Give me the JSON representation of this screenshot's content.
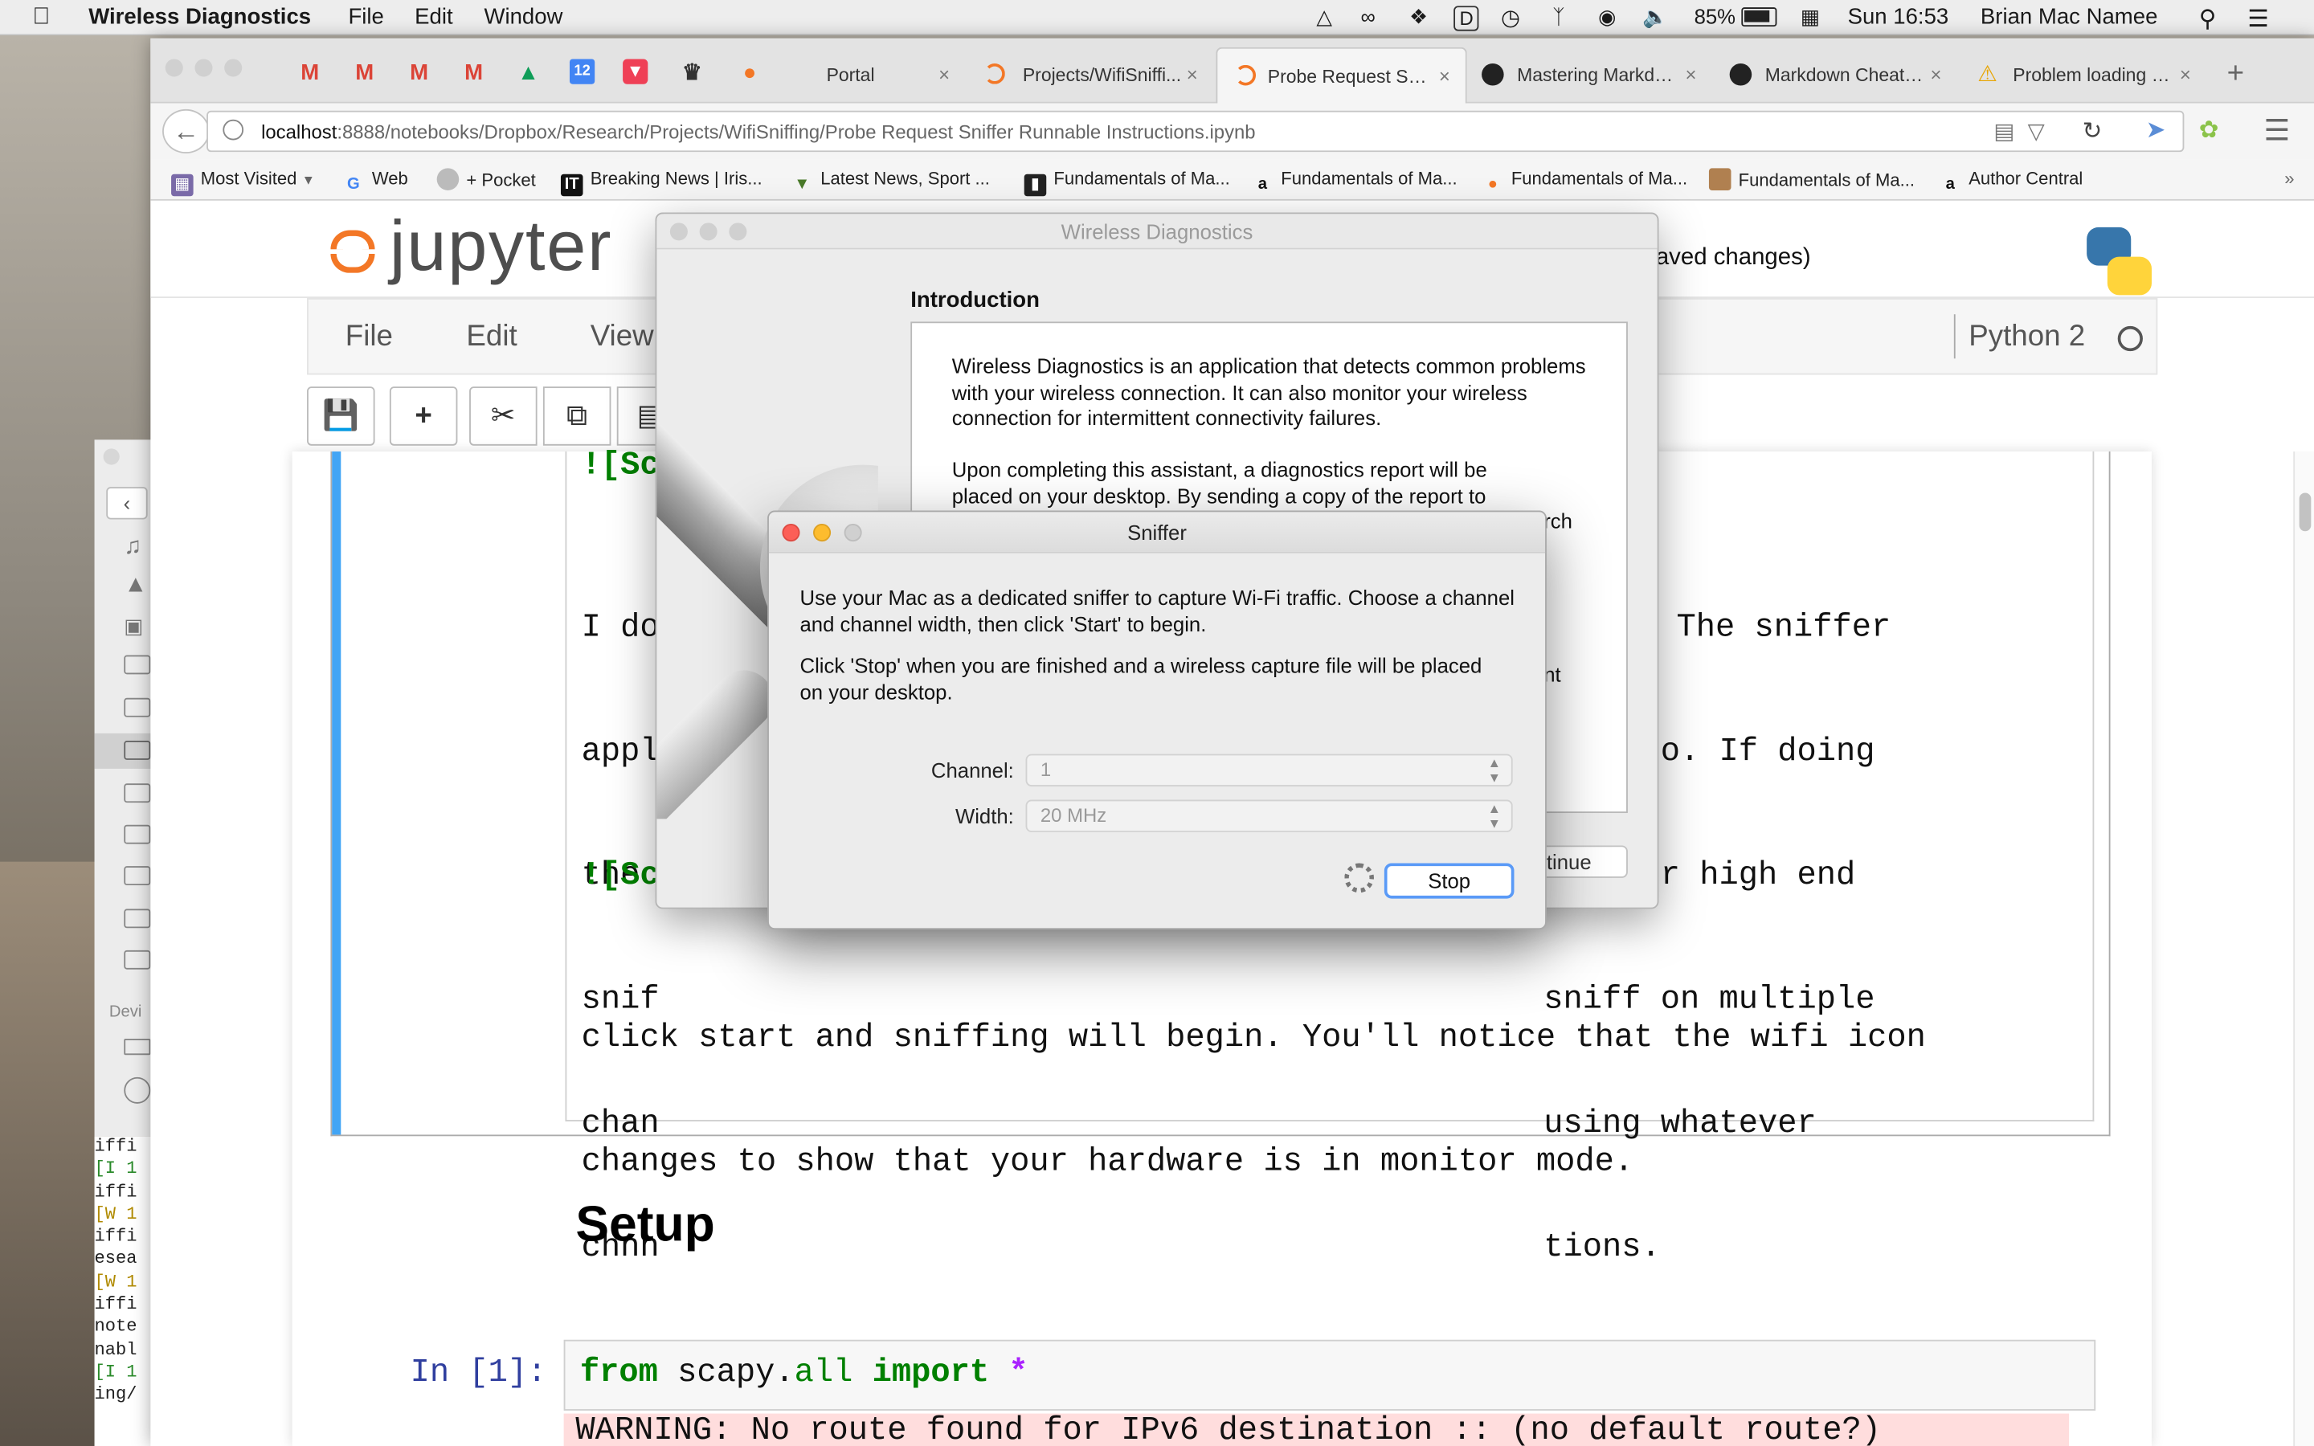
{
  "menubar": {
    "app_name": "Wireless Diagnostics",
    "menus": [
      "File",
      "Edit",
      "Window"
    ],
    "battery": "85%",
    "clock": "Sun 16:53",
    "user": "Brian Mac Namee"
  },
  "browser": {
    "tabs": [
      {
        "title": "Portal"
      },
      {
        "title": "Projects/WifiSniffi..."
      },
      {
        "title": "Probe Request Sni...",
        "active": true
      },
      {
        "title": "Mastering Markdo..."
      },
      {
        "title": "Markdown Cheats..."
      },
      {
        "title": "Problem loading p..."
      }
    ],
    "url": {
      "host": "localhost",
      "path": ":8888/notebooks/Dropbox/Research/Projects/WifiSniffing/Probe Request Sniffer Runnable Instructions.ipynb"
    },
    "bookmarks": [
      "Most Visited",
      "Web",
      "+ Pocket",
      "Breaking News | Iris...",
      "Latest News, Sport ...",
      "Fundamentals of Ma...",
      "Fundamentals of Ma...",
      "Fundamentals of Ma...",
      "Fundamentals of Ma...",
      "Author Central"
    ]
  },
  "jupyter": {
    "logo_text": "jupyter",
    "save_status": "aved changes)",
    "menu": [
      "File",
      "Edit",
      "View"
    ],
    "kernel": "Python 2",
    "cell_md": {
      "line1": "![Sc",
      "para": [
        "I do",
        "appl",
        "the ",
        "snif",
        "chan",
        "chnn"
      ],
      "para_right": [
        "The sniffer",
        "cted to. If doing",
        "ing, or high end",
        "sniff on multiple",
        "using whatever",
        "tions."
      ],
      "line2": "![Sc",
      "para2": [
        "click start and sniffing will begin. You'll notice that the wifi icon",
        "changes to show that your hardware is in monitor mode."
      ]
    },
    "heading": "Setup",
    "prompt": "In [1]:",
    "code": {
      "kw1": "from",
      "mod1": "scapy",
      "dot": ".",
      "mod2": "all",
      "kw2": "import",
      "star": "*"
    },
    "warning": "WARNING: No route found for IPv6 destination :: (no default route?)"
  },
  "finder": {
    "devices_label": "Devi"
  },
  "terminal": {
    "lines": [
      "iffi",
      "[I 1",
      "iffi",
      "[W 1",
      "iffi",
      "esea",
      "[W 1",
      "iffi",
      "note",
      "nabl",
      "[I 1",
      "ing/"
    ]
  },
  "wireless_diagnostics": {
    "title": "Wireless Diagnostics",
    "heading": "Introduction",
    "p1": "Wireless Diagnostics is an application that detects common problems with your wireless connection. It can also monitor your wireless connection for intermittent connectivity failures.",
    "p2_line1": "Upon completing this assistant, a diagnostics report will be",
    "p2_line2": "placed on your desktop. By sending a copy of the report to",
    "p2_tail": "rch",
    "p3_tail": "nt",
    "continue_button": "tinue"
  },
  "sniffer": {
    "title": "Sniffer",
    "p1": "Use your Mac as a dedicated sniffer to capture Wi-Fi traffic.  Choose a channel and channel width, then click 'Start' to begin.",
    "p2": "Click 'Stop' when you are finished and a wireless capture file will be placed on your desktop.",
    "channel_label": "Channel:",
    "channel_value": "1",
    "width_label": "Width:",
    "width_value": "20 MHz",
    "stop_button": "Stop"
  },
  "colors": {
    "jupyter_orange": "#f37726",
    "cell_selected": "#42a5f5",
    "keyword_green": "#008000",
    "prompt_blue": "#303f9f",
    "warning_bg": "#fdd",
    "stop_button_border": "#5a9af7"
  }
}
